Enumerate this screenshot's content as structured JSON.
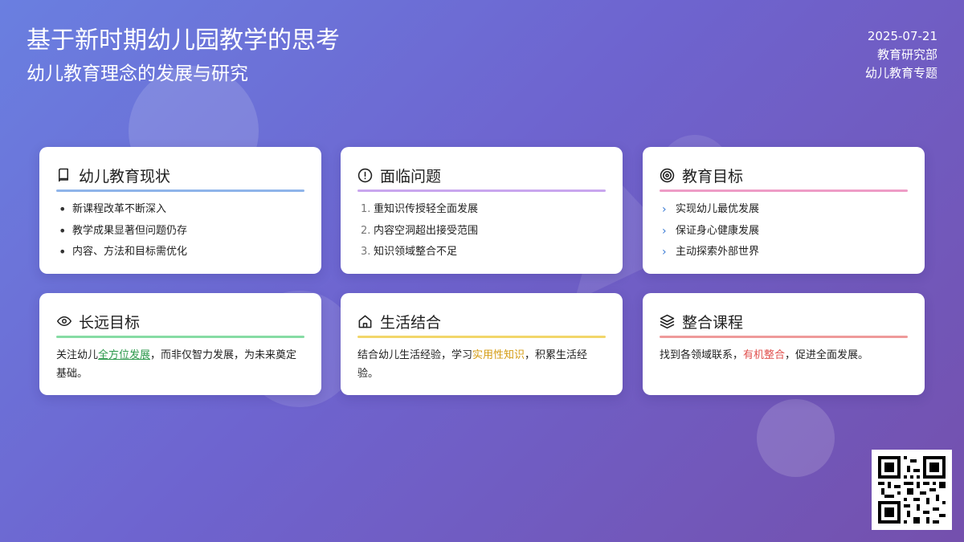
{
  "header": {
    "title": "基于新时期幼儿园教学的思考",
    "subtitle": "幼儿教育理念的发展与研究",
    "date": "2025-07-21",
    "department": "教育研究部",
    "topic": "幼儿教育专题"
  },
  "colors": {
    "blue": "#8fb4ea",
    "purple": "#c9a6ee",
    "pink": "#ee9cc6",
    "green": "#86dca4",
    "yellow": "#f2d66a",
    "red": "#ef9a9a"
  },
  "cards": [
    {
      "title": "幼儿教育现状",
      "icon": "book-icon",
      "items": [
        "新课程改革不断深入",
        "教学成果显著但问题仍存",
        "内容、方法和目标需优化"
      ]
    },
    {
      "title": "面临问题",
      "icon": "alert-circle-icon",
      "items": [
        {
          "num": "1.",
          "text": "重知识传授轻全面发展"
        },
        {
          "num": "2.",
          "text": "内容空洞超出接受范围"
        },
        {
          "num": "3.",
          "text": "知识领域整合不足"
        }
      ]
    },
    {
      "title": "教育目标",
      "icon": "target-icon",
      "items": [
        "实现幼儿最优发展",
        "保证身心健康发展",
        "主动探索外部世界"
      ]
    },
    {
      "title": "长远目标",
      "icon": "eye-icon",
      "text_before": "关注幼儿",
      "highlight": "全方位发展",
      "text_after": "，而非仅智力发展，为未来奠定基础。"
    },
    {
      "title": "生活结合",
      "icon": "home-icon",
      "text_before": "结合幼儿生活经验，学习",
      "highlight": "实用性知识",
      "text_after": "，积累生活经验。"
    },
    {
      "title": "整合课程",
      "icon": "layers-icon",
      "text_before": "找到各领域联系，",
      "highlight": "有机整合",
      "text_after": "，促进全面发展。"
    }
  ],
  "qr": {
    "icon": "qr-code-icon"
  }
}
